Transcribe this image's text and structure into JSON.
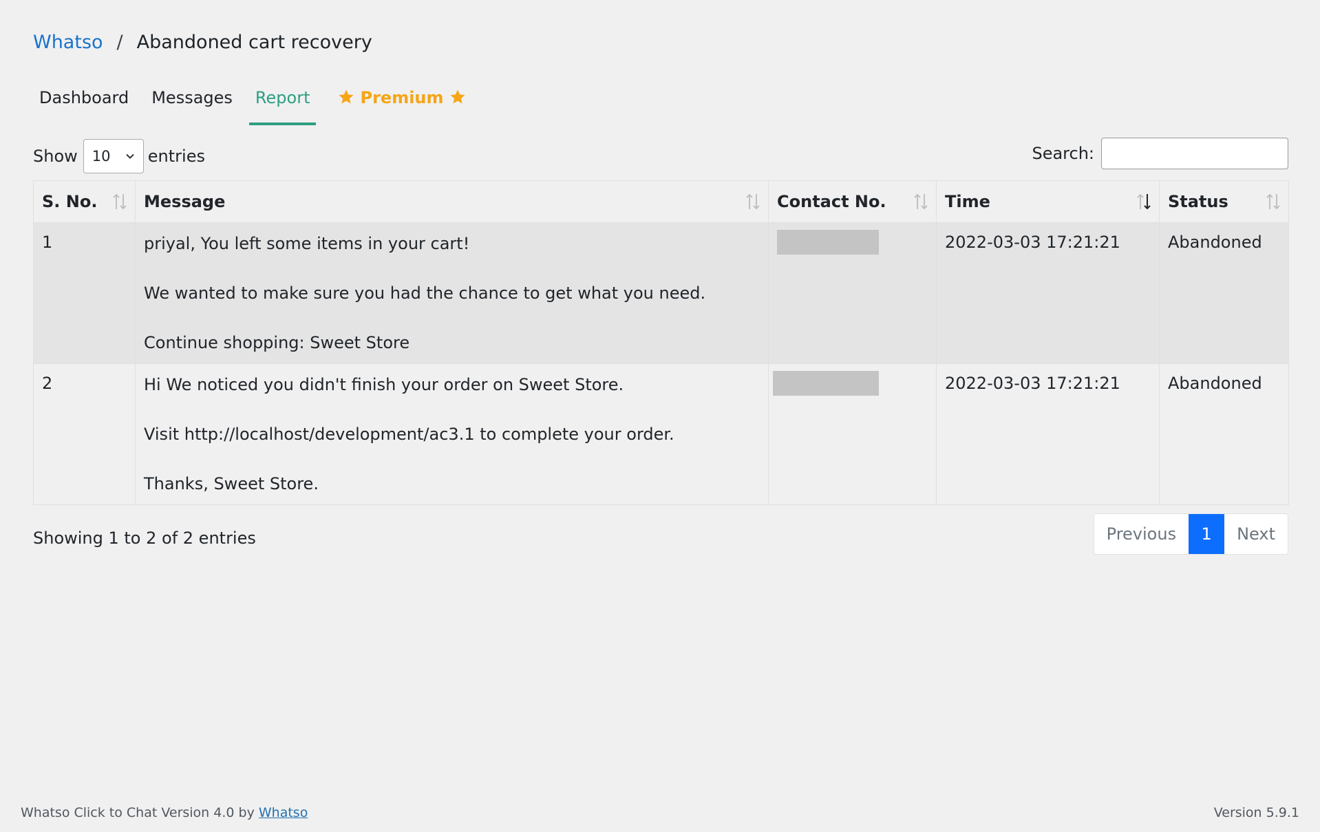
{
  "breadcrumb": {
    "root": "Whatso",
    "separator": "/",
    "current": "Abandoned cart recovery"
  },
  "tabs": [
    {
      "label": "Dashboard",
      "active": false
    },
    {
      "label": "Messages",
      "active": false
    },
    {
      "label": "Report",
      "active": true
    },
    {
      "label": "Premium",
      "active": false,
      "icon": "star-icon",
      "color": "#f5a516"
    }
  ],
  "length_control": {
    "show_label": "Show",
    "selected": "10",
    "entries_label": "entries"
  },
  "search": {
    "label": "Search:",
    "value": ""
  },
  "table": {
    "columns": [
      "S. No.",
      "Message",
      "Contact No.",
      "Time",
      "Status"
    ],
    "rows": [
      {
        "sno": "1",
        "message": [
          "priyal, You left some items in your cart!",
          "We wanted to make sure you had the chance to get what you need.",
          "Continue shopping: Sweet Store"
        ],
        "contact": "",
        "time": "2022-03-03 17:21:21",
        "status": "Abandoned"
      },
      {
        "sno": "2",
        "message": [
          "Hi We noticed you didn't finish your order on Sweet Store.",
          "Visit http://localhost/development/ac3.1 to complete your order.",
          "Thanks, Sweet Store."
        ],
        "contact": "",
        "time": "2022-03-03 17:21:21",
        "status": "Abandoned"
      }
    ]
  },
  "info": "Showing 1 to 2 of 2 entries",
  "pagination": {
    "previous": "Previous",
    "current": "1",
    "next": "Next"
  },
  "footer": {
    "left_text": "Whatso Click to Chat Version 4.0 by",
    "left_link": "Whatso",
    "version": "Version 5.9.1"
  },
  "colors": {
    "accent": "#2e9e80",
    "link": "#1a73c9",
    "premium": "#f5a516",
    "page_active": "#0d6efd"
  }
}
